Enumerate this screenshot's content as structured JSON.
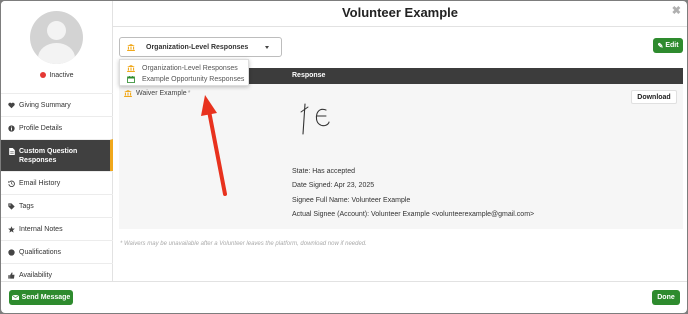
{
  "header": {
    "title": "Volunteer Example",
    "close_icon": "close-icon"
  },
  "profile": {
    "status": "Inactive",
    "status_color": "#e53935"
  },
  "sidebar": {
    "items": [
      {
        "label": "Giving Summary",
        "icon": "heart-icon",
        "active": false
      },
      {
        "label": "Profile Details",
        "icon": "info-icon",
        "active": false
      },
      {
        "label": "Custom Question Responses",
        "icon": "document-icon",
        "active": true
      },
      {
        "label": "Email History",
        "icon": "history-icon",
        "active": false
      },
      {
        "label": "Tags",
        "icon": "tag-icon",
        "active": false
      },
      {
        "label": "Internal Notes",
        "icon": "star-icon",
        "active": false
      },
      {
        "label": "Qualifications",
        "icon": "circle-icon",
        "active": false
      },
      {
        "label": "Availability",
        "icon": "thumbs-up-icon",
        "active": false
      }
    ]
  },
  "filter": {
    "selected": "Organization-Level Responses",
    "options": [
      {
        "label": "Organization-Level Responses",
        "icon": "bank-icon"
      },
      {
        "label": "Example Opportunity Responses",
        "icon": "calendar-icon"
      }
    ]
  },
  "toolbar": {
    "edit_label": "Edit"
  },
  "table": {
    "headers": {
      "response": "Response"
    },
    "row": {
      "question": "Waiver Example",
      "required_mark": "*",
      "download_label": "Download",
      "details": [
        "State: Has accepted",
        "Date Signed: Apr 23, 2025",
        "Signee Full Name: Volunteer Example",
        "Actual Signee (Account): Volunteer Example <volunteerexample@gmail.com>"
      ]
    }
  },
  "footnote": "* Waivers may be unavailable after a Volunteer leaves the platform, download now if needed.",
  "footer": {
    "send_label": "Send Message",
    "done_label": "Done"
  },
  "colors": {
    "accent_green": "#2e8b2e",
    "accent_orange": "#f0a81c",
    "arrow_red": "#e8321e"
  }
}
